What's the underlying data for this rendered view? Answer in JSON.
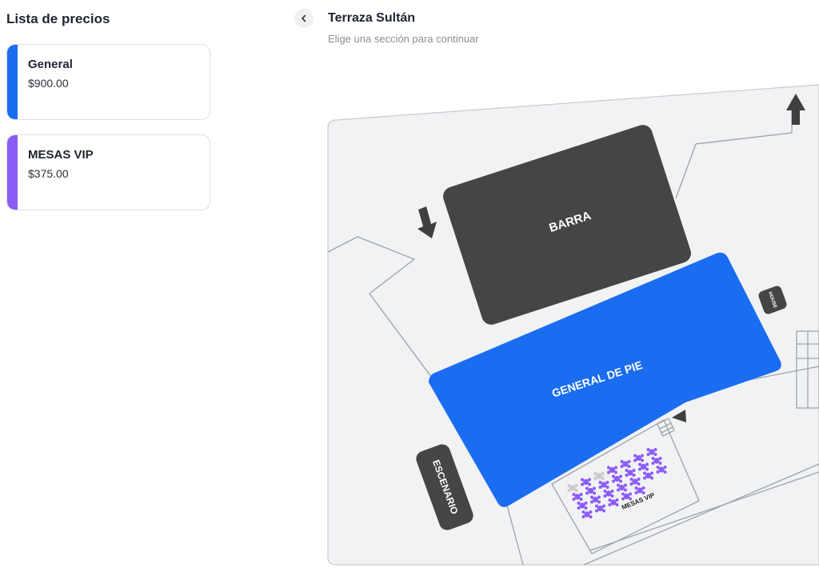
{
  "price_list": {
    "title": "Lista de precios",
    "items": [
      {
        "name": "General",
        "price": "$900.00",
        "color": "#1a6cf0"
      },
      {
        "name": "MESAS VIP",
        "price": "$375.00",
        "color": "#8b5cf6"
      }
    ]
  },
  "venue": {
    "back_icon": "chevron-left-icon",
    "title": "Terraza Sultán",
    "subtitle": "Elige una sección para continuar",
    "sections": {
      "barra": {
        "label": "BARRA",
        "color": "#454545"
      },
      "general": {
        "label": "GENERAL DE PIE",
        "color": "#1a6cf0"
      },
      "escenario": {
        "label": "ESCENARIO",
        "color": "#454545"
      },
      "house": {
        "label": "HOUSE",
        "color": "#454545"
      },
      "mesas_vip": {
        "label": "MESAS VIP",
        "seat_color": "#8b5cf6",
        "unavailable_color": "#c9c9c9"
      }
    },
    "map_background": "#f1f2f4"
  }
}
